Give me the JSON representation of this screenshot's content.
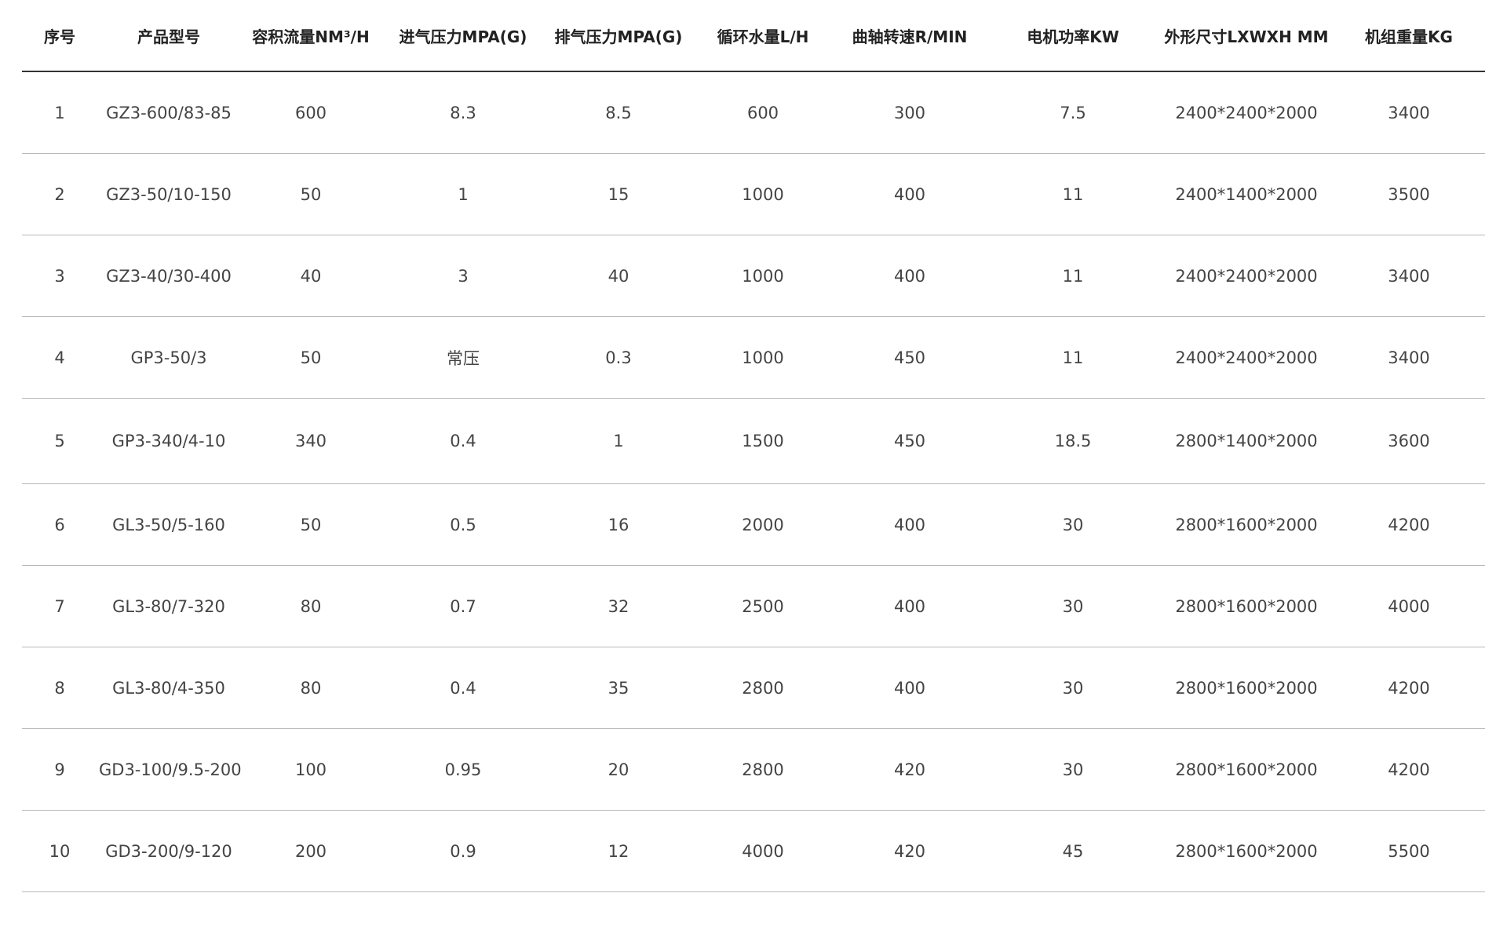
{
  "table": {
    "headers": [
      "序号",
      "产品型号",
      "容积流量NM³/H",
      "进气压力MPA(G)",
      "排气压力MPA(G)",
      "循环水量L/H",
      "曲轴转速R/MIN",
      "电机功率KW",
      "外形尺寸LXWXH MM",
      "机组重量KG"
    ],
    "rows": [
      [
        "1",
        "GZ3-600/83-85",
        "600",
        "8.3",
        "8.5",
        "600",
        "300",
        "7.5",
        "2400*2400*2000",
        "3400"
      ],
      [
        "2",
        "GZ3-50/10-150",
        "50",
        "1",
        "15",
        "1000",
        "400",
        "11",
        "2400*1400*2000",
        "3500"
      ],
      [
        "3",
        "GZ3-40/30-400",
        "40",
        "3",
        "40",
        "1000",
        "400",
        "11",
        "2400*2400*2000",
        "3400"
      ],
      [
        "4",
        "GP3-50/3",
        "50",
        "常压",
        "0.3",
        "1000",
        "450",
        "11",
        "2400*2400*2000",
        "3400"
      ],
      [
        "5",
        "GP3-340/4-10",
        "340",
        "0.4",
        "1",
        "1500",
        "450",
        "18.5",
        "2800*1400*2000",
        "3600"
      ],
      [
        "6",
        "GL3-50/5-160",
        "50",
        "0.5",
        "16",
        "2000",
        "400",
        "30",
        "2800*1600*2000",
        "4200"
      ],
      [
        "7",
        "GL3-80/7-320",
        "80",
        "0.7",
        "32",
        "2500",
        "400",
        "30",
        "2800*1600*2000",
        "4000"
      ],
      [
        "8",
        "GL3-80/4-350",
        "80",
        "0.4",
        "35",
        "2800",
        "400",
        "30",
        "2800*1600*2000",
        "4200"
      ],
      [
        "9",
        "GD3-100/9.5-200",
        "100",
        "0.95",
        "20",
        "2800",
        "420",
        "30",
        "2800*1600*2000",
        "4200"
      ],
      [
        "10",
        "GD3-200/9-120",
        "200",
        "0.9",
        "12",
        "4000",
        "420",
        "45",
        "2800*1600*2000",
        "5500"
      ]
    ]
  }
}
